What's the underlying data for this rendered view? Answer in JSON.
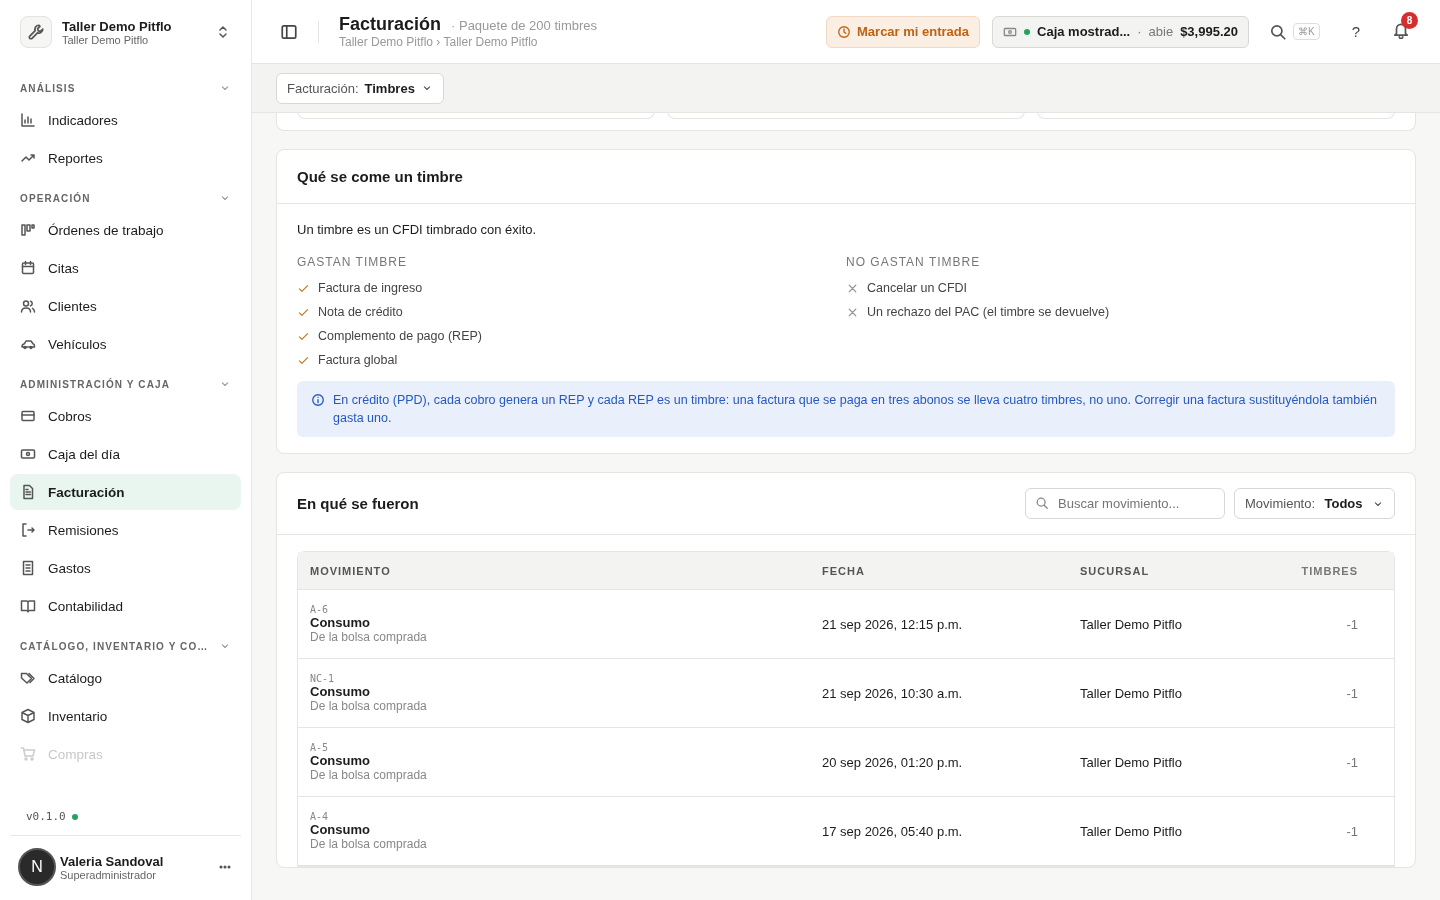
{
  "workspace": {
    "name": "Taller Demo Pitflo",
    "subtitle": "Taller Demo Pitflo"
  },
  "sidebar": {
    "sections": [
      {
        "title": "ANÁLISIS",
        "expanded": true,
        "items": [
          {
            "label": "Indicadores",
            "selected": false
          },
          {
            "label": "Reportes",
            "selected": false
          }
        ]
      },
      {
        "title": "OPERACIÓN",
        "expanded": true,
        "items": [
          {
            "label": "Órdenes de trabajo",
            "selected": false
          },
          {
            "label": "Citas",
            "selected": false
          },
          {
            "label": "Clientes",
            "selected": false
          },
          {
            "label": "Vehículos",
            "selected": false
          }
        ]
      },
      {
        "title": "ADMINISTRACIÓN Y CAJA",
        "expanded": true,
        "items": [
          {
            "label": "Cobros",
            "selected": false
          },
          {
            "label": "Caja del día",
            "selected": false
          },
          {
            "label": "Facturación",
            "selected": true
          },
          {
            "label": "Remisiones",
            "selected": false
          },
          {
            "label": "Gastos",
            "selected": false
          },
          {
            "label": "Contabilidad",
            "selected": false
          }
        ]
      },
      {
        "title": "CATÁLOGO, INVENTARIO Y CO…",
        "expanded": true,
        "items": [
          {
            "label": "Catálogo",
            "selected": false
          },
          {
            "label": "Inventario",
            "selected": false
          },
          {
            "label": "Compras",
            "selected": false
          }
        ]
      }
    ],
    "version": "v0.1.0",
    "user": {
      "initial": "N",
      "name": "Valeria Sandoval",
      "role": "Superadministrador"
    }
  },
  "header": {
    "title": "Facturación",
    "subtitle": "· Paquete de 200 timbres",
    "breadcrumb": "Taller Demo Pitflo › Taller Demo Pitflo",
    "clock_button": "Marcar mi entrada",
    "register": {
      "name": "Caja mostrad...",
      "separator": "·",
      "status": "abie",
      "amount": "$3,995.20"
    },
    "shortcut": "⌘K",
    "help": "?",
    "notifications": "8"
  },
  "filter": {
    "label": "Facturación:",
    "value": "Timbres"
  },
  "info_card": {
    "title": "Qué se come un timbre",
    "intro": "Un timbre es un CFDI timbrado con éxito.",
    "columns": [
      {
        "heading": "GASTAN TIMBRE",
        "kind": "spends",
        "items": [
          "Factura de ingreso",
          "Nota de crédito",
          "Complemento de pago (REP)",
          "Factura global"
        ]
      },
      {
        "heading": "NO GASTAN TIMBRE",
        "kind": "free",
        "items": [
          "Cancelar un CFDI",
          "Un rechazo del PAC (el timbre se devuelve)"
        ]
      }
    ],
    "note": "En crédito (PPD), cada cobro genera un REP y cada REP es un timbre: una factura que se paga en tres abonos se lleva cuatro timbres, no uno. Corregir una factura sustituyéndola también gasta uno."
  },
  "movements": {
    "title": "En qué se fueron",
    "search": {
      "placeholder": "Buscar movimiento..."
    },
    "filter": {
      "label": "Movimiento:",
      "value": "Todos"
    },
    "table": {
      "columns": [
        "MOVIMIENTO",
        "FECHA",
        "SUCURSAL",
        "TIMBRES"
      ],
      "rows": [
        {
          "code": "A-6",
          "title": "Consumo",
          "detail": "De la bolsa comprada",
          "date": "21 sep 2026, 12:15 p.m.",
          "branch": "Taller Demo Pitflo",
          "stamps": "-1"
        },
        {
          "code": "NC-1",
          "title": "Consumo",
          "detail": "De la bolsa comprada",
          "date": "21 sep 2026, 10:30 a.m.",
          "branch": "Taller Demo Pitflo",
          "stamps": "-1"
        },
        {
          "code": "A-5",
          "title": "Consumo",
          "detail": "De la bolsa comprada",
          "date": "20 sep 2026, 01:20 p.m.",
          "branch": "Taller Demo Pitflo",
          "stamps": "-1"
        },
        {
          "code": "A-4",
          "title": "Consumo",
          "detail": "De la bolsa comprada",
          "date": "17 sep 2026, 05:40 p.m.",
          "branch": "Taller Demo Pitflo",
          "stamps": "-1"
        }
      ]
    }
  }
}
